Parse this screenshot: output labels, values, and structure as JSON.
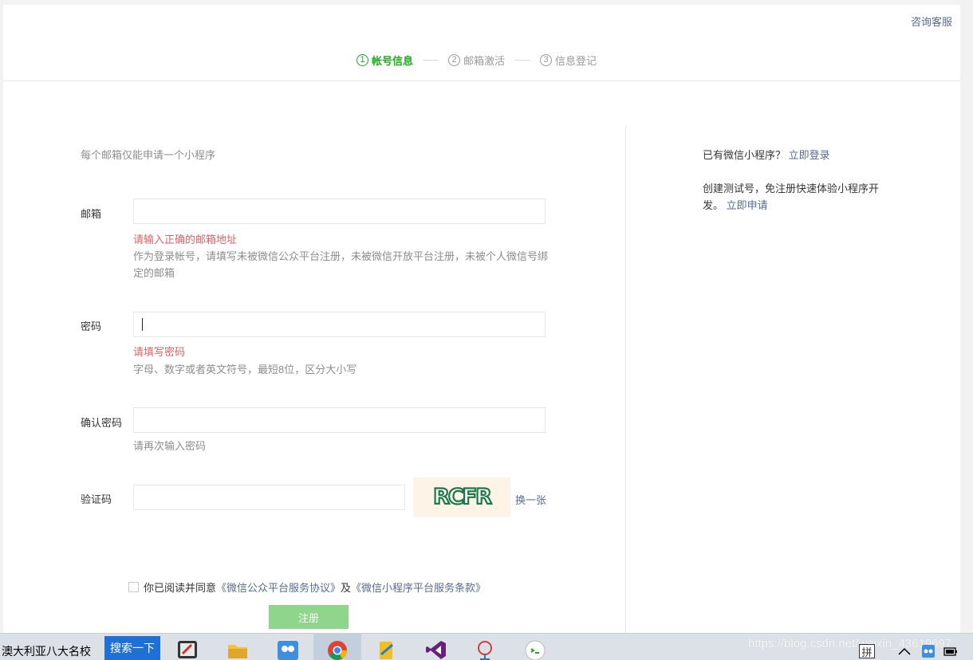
{
  "header": {
    "support_link": "咨询客服",
    "steps": [
      {
        "num": "1",
        "label": "帐号信息",
        "active": true
      },
      {
        "num": "2",
        "label": "邮箱激活",
        "active": false
      },
      {
        "num": "3",
        "label": "信息登记",
        "active": false
      }
    ]
  },
  "form": {
    "tip": "每个邮箱仅能申请一个小程序",
    "email": {
      "label": "邮箱",
      "value": "",
      "error": "请输入正确的邮箱地址",
      "description": "作为登录帐号，请填写未被微信公众平台注册，未被微信开放平台注册，未被个人微信号绑定的邮箱"
    },
    "password": {
      "label": "密码",
      "value": "",
      "error": "请填写密码",
      "description": "字母、数字或者英文符号，最短8位，区分大小写"
    },
    "confirm_password": {
      "label": "确认密码",
      "value": "",
      "description": "请再次输入密码"
    },
    "captcha": {
      "label": "验证码",
      "value": "",
      "image_text": "RCFR",
      "refresh_label": "换一张"
    },
    "agreement": {
      "checked": false,
      "prefix": "你已阅读并同意",
      "link1": "《微信公众平台服务协议》",
      "middle": "及",
      "link2": "《微信小程序平台服务条款》"
    },
    "submit_label": "注册",
    "submit_color": "#8fd68c"
  },
  "sidebar": {
    "has_account_text": "已有微信小程序？",
    "login_link": "立即登录",
    "test_account_text": "创建测试号，免注册快速体验小程序开发。",
    "apply_link": "立即申请"
  },
  "taskbar": {
    "search_text": "澳大利亚八大名校",
    "search_button": "搜索一下",
    "ime_label": "拼",
    "watermark": "https://blog.csdn.net/weixin_43619697"
  },
  "colors": {
    "accent_green": "#1aad19",
    "link_blue": "#576b95",
    "error_red": "#e15f63"
  }
}
